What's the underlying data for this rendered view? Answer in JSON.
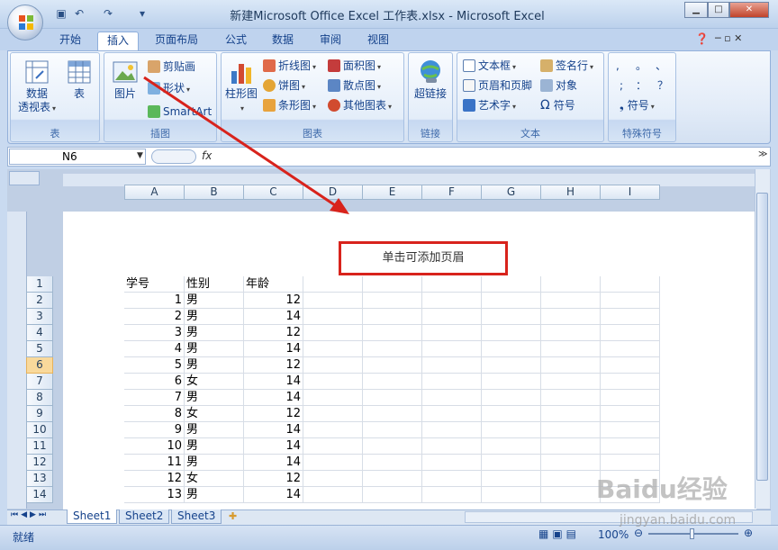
{
  "window": {
    "title": "新建Microsoft Office Excel 工作表.xlsx - Microsoft Excel"
  },
  "qat": {
    "save_icon": "save-icon",
    "undo_icon": "undo-icon",
    "redo_icon": "redo-icon",
    "customize_icon": "chevron-down-icon"
  },
  "tabs": [
    {
      "label": "开始"
    },
    {
      "label": "插入",
      "active": true
    },
    {
      "label": "页面布局"
    },
    {
      "label": "公式"
    },
    {
      "label": "数据"
    },
    {
      "label": "审阅"
    },
    {
      "label": "视图"
    }
  ],
  "ribbon": {
    "groups": [
      {
        "label": "表",
        "buttons": [
          "数据\n透视表",
          "表"
        ]
      },
      {
        "label": "插图",
        "big": "图片",
        "small": [
          "剪贴画",
          "形状",
          "SmartArt"
        ]
      },
      {
        "label": "图表",
        "big": "柱形图",
        "small": [
          "折线图",
          "面积图",
          "饼图",
          "散点图",
          "条形图",
          "其他图表"
        ]
      },
      {
        "label": "链接",
        "big": "超链接"
      },
      {
        "label": "文本",
        "small": [
          "文本框",
          "签名行",
          "页眉和页脚",
          "对象",
          "艺术字",
          "符号"
        ]
      },
      {
        "label": "特殊符号",
        "small": [
          ",",
          "。",
          "、",
          ";",
          "：",
          "？",
          "符号"
        ]
      }
    ],
    "pivot_line1": "数据",
    "pivot_line2": "透视表",
    "table": "表",
    "picture": "图片",
    "clipart": "剪贴画",
    "shapes": "形状",
    "smartart": "SmartArt",
    "column": "柱形图",
    "line": "折线图",
    "area": "面积图",
    "pie": "饼图",
    "scatter": "散点图",
    "bar": "条形图",
    "other": "其他图表",
    "hyperlink": "超链接",
    "textbox": "文本框",
    "signature": "签名行",
    "headerfooter": "页眉和页脚",
    "object": "对象",
    "wordart": "艺术字",
    "symbol": "符号",
    "sp1": ",",
    "sp2": "。",
    "sp3": "、",
    "sp4": ";",
    "sp5": "：",
    "sp6": "？",
    "sp_symbol": "符号",
    "g_table": "表",
    "g_illus": "插图",
    "g_chart": "图表",
    "g_link": "链接",
    "g_text": "文本",
    "g_special": "特殊符号"
  },
  "formula_bar": {
    "name_box": "N6",
    "fx": "fx",
    "value": ""
  },
  "columns": [
    "A",
    "B",
    "C",
    "D",
    "E",
    "F",
    "G",
    "H",
    "I"
  ],
  "header_hint": "单击可添加页眉",
  "rows": [
    {
      "n": "1",
      "a": "学号",
      "b": "性别",
      "c": "年龄"
    },
    {
      "n": "2",
      "a": "1",
      "b": "男",
      "c": "12"
    },
    {
      "n": "3",
      "a": "2",
      "b": "男",
      "c": "14"
    },
    {
      "n": "4",
      "a": "3",
      "b": "男",
      "c": "12"
    },
    {
      "n": "5",
      "a": "4",
      "b": "男",
      "c": "14"
    },
    {
      "n": "6",
      "a": "5",
      "b": "男",
      "c": "12"
    },
    {
      "n": "7",
      "a": "6",
      "b": "女",
      "c": "14"
    },
    {
      "n": "8",
      "a": "7",
      "b": "男",
      "c": "14"
    },
    {
      "n": "9",
      "a": "8",
      "b": "女",
      "c": "12"
    },
    {
      "n": "10",
      "a": "9",
      "b": "男",
      "c": "14"
    },
    {
      "n": "11",
      "a": "10",
      "b": "男",
      "c": "14"
    },
    {
      "n": "12",
      "a": "11",
      "b": "男",
      "c": "14"
    },
    {
      "n": "13",
      "a": "12",
      "b": "女",
      "c": "12"
    },
    {
      "n": "14",
      "a": "13",
      "b": "男",
      "c": "14"
    }
  ],
  "sheets": [
    "Sheet1",
    "Sheet2",
    "Sheet3"
  ],
  "status": {
    "ready": "就绪",
    "zoom": "100%"
  },
  "watermark": {
    "logo": "Baidu经验",
    "url": "jingyan.baidu.com"
  },
  "colors": {
    "annotation": "#d8231c",
    "ribbon": "#dfe9f5",
    "selected_row": "#f9d99b"
  }
}
